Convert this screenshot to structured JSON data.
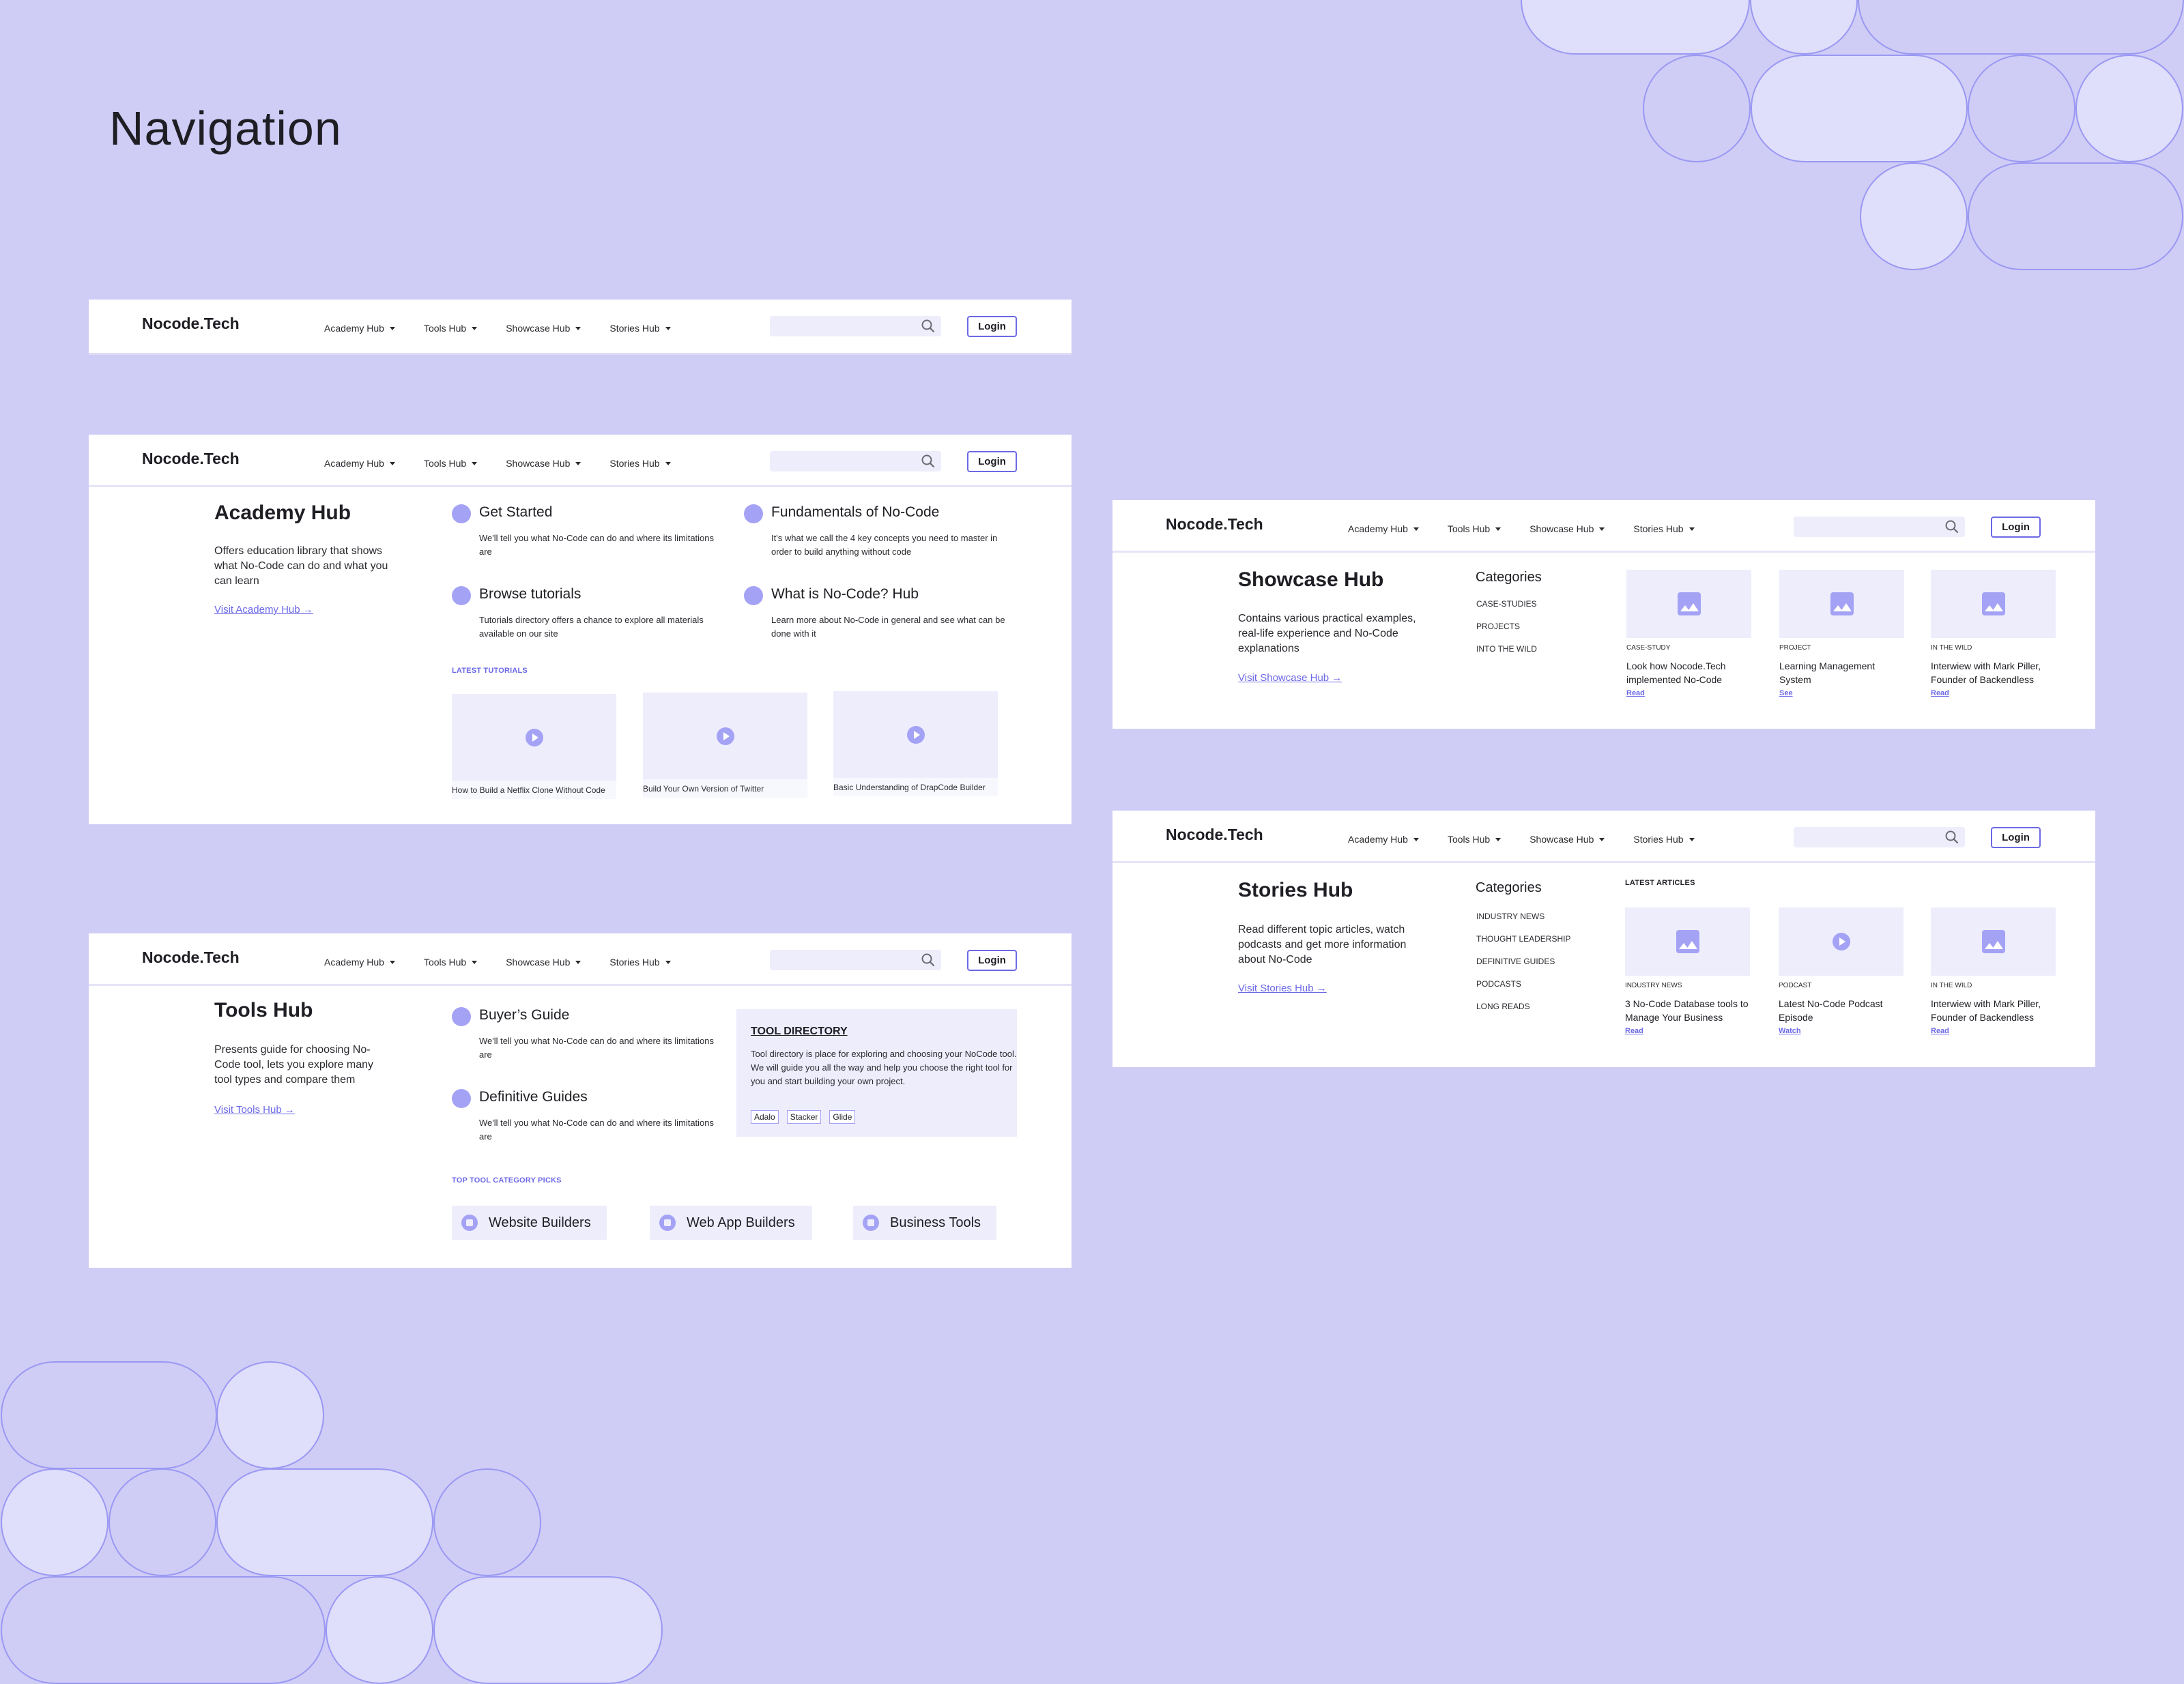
{
  "page": {
    "title": "Navigation"
  },
  "colors": {
    "background": "#cfcdf6",
    "accent": "#6c69e6",
    "accent_light": "#a4a2f5",
    "tint": "#eeedfc",
    "text": "#1e1e24"
  },
  "nav": {
    "logo": "Nocode.Tech",
    "menu": [
      {
        "label": "Academy Hub",
        "icon": "caret-down-icon"
      },
      {
        "label": "Tools Hub",
        "icon": "caret-down-icon"
      },
      {
        "label": "Showcase Hub",
        "icon": "caret-down-icon"
      },
      {
        "label": "Stories Hub",
        "icon": "caret-down-icon"
      }
    ],
    "search": {
      "placeholder": "",
      "value": "",
      "icon": "search-icon"
    },
    "login_label": "Login"
  },
  "academy": {
    "title": "Academy Hub",
    "description": "Offers education library that shows what No-Code can do and what you can learn",
    "link": "Visit Academy Hub →",
    "features": [
      {
        "title": "Get Started",
        "description": "We'll tell you what No-Code can do and where its limitations are"
      },
      {
        "title": "Fundamentals of No-Code",
        "description": "It's what we call the 4 key concepts you need to master in order to build anything without code"
      },
      {
        "title": "Browse tutorials",
        "description": "Tutorials directory offers a chance to explore all materials available on our site"
      },
      {
        "title": "What is No-Code? Hub",
        "description": "Learn more about No-Code in general and see what can be done with it"
      }
    ],
    "section_label": "LATEST TUTORIALS",
    "tutorials": [
      {
        "caption": "How to Build a Netflix Clone Without Code",
        "icon": "play-icon"
      },
      {
        "caption": "Build Your Own Version of Twitter",
        "icon": "play-icon"
      },
      {
        "caption": "Basic Understanding of DrapCode Builder",
        "icon": "play-icon"
      }
    ]
  },
  "tools": {
    "title": "Tools Hub",
    "description": "Presents guide for choosing No-Code tool, lets you explore many tool types and compare them",
    "link": "Visit Tools Hub →",
    "features": [
      {
        "title": "Buyer’s Guide",
        "description": "We'll tell you what No-Code can do and where its limitations are"
      },
      {
        "title": "Definitive Guides",
        "description": "We'll tell you what No-Code can do and where its limitations are"
      }
    ],
    "directory": {
      "title": "TOOL DIRECTORY",
      "description": "Tool directory is place for exploring and choosing your NoCode tool. We will guide you all the way and help you choose the right tool for you and start building your own project.",
      "tags": [
        "Adalo",
        "Stacker",
        "Glide"
      ]
    },
    "section_label": "TOP TOOL CATEGORY PICKS",
    "picks": [
      {
        "label": "Website Builders",
        "icon": "image-icon"
      },
      {
        "label": "Web App Builders",
        "icon": "image-icon"
      },
      {
        "label": "Business Tools",
        "icon": "image-icon"
      }
    ]
  },
  "showcase": {
    "title": "Showcase Hub",
    "description": "Contains various practical examples, real-life experience and No-Code explanations",
    "link": "Visit Showcase Hub →",
    "categories_title": "Categories",
    "categories": [
      "CASE-STUDIES",
      "PROJECTS",
      "INTO THE WILD"
    ],
    "cards": [
      {
        "tag": "CASE-STUDY",
        "title": "Look how Nocode.Tech implemented No-Code",
        "action": "Read",
        "icon": "image-icon"
      },
      {
        "tag": "PROJECT",
        "title": "Learning Management System",
        "action": "See",
        "icon": "image-icon"
      },
      {
        "tag": "IN THE WILD",
        "title": "Interwiew with Mark Piller, Founder of Backendless",
        "action": "Read",
        "icon": "image-icon"
      }
    ]
  },
  "stories": {
    "title": "Stories Hub",
    "description": "Read different topic articles, watch podcasts and get more information about No-Code",
    "link": "Visit Stories Hub →",
    "categories_title": "Categories",
    "categories": [
      "INDUSTRY NEWS",
      "THOUGHT LEADERSHIP",
      "DEFINITIVE GUIDES",
      "PODCASTS",
      "LONG READS"
    ],
    "section_label": "LATEST ARTICLES",
    "cards": [
      {
        "tag": "INDUSTRY NEWS",
        "title": "3 No-Code Database tools to Manage Your Business",
        "action": "Read",
        "icon": "image-icon"
      },
      {
        "tag": "PODCAST",
        "title": "Latest No-Code Podcast Episode",
        "action": "Watch",
        "icon": "play-icon"
      },
      {
        "tag": "IN THE WILD",
        "title": "Interwiew with Mark Piller, Founder of Backendless",
        "action": "Read",
        "icon": "image-icon"
      }
    ]
  }
}
